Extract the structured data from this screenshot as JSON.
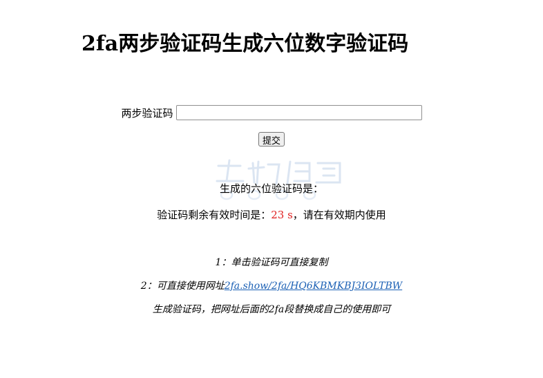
{
  "page": {
    "title": "2fa两步验证码生成六位数字验证码"
  },
  "form": {
    "label": "两步验证码",
    "input_value": "",
    "submit_label": "提交"
  },
  "result": {
    "label": "生成的六位验证码是：",
    "code": ""
  },
  "timer": {
    "prefix": "验证码剩余有效时间是：",
    "value": "23 s",
    "suffix": "，请在有效期内使用"
  },
  "notes": {
    "note1": "1：单击验证码可直接复制",
    "note2_prefix": "2：可直接使用网址",
    "note2_link": "2fa.show/2fa/HQ6KBMKBJ3IOLTBW",
    "note3": "生成验证码，把网址后面的2fa段替换成自己的使用即可"
  },
  "colors": {
    "timer": "#e01f1f",
    "link": "#1a5fb4",
    "watermark": "#c9d8ea"
  }
}
